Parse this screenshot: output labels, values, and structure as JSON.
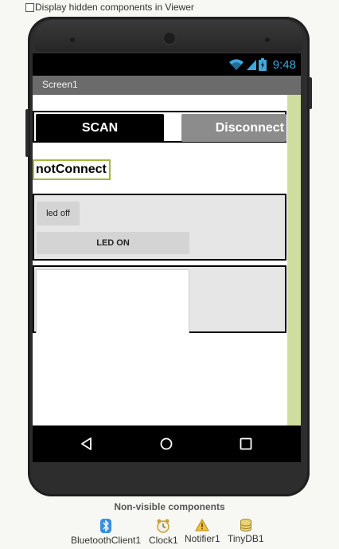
{
  "viewer": {
    "hidden_components_label": "Display hidden components in Viewer",
    "hidden_components_checked": false
  },
  "status_bar": {
    "time": "9:48",
    "icons": [
      "wifi-icon",
      "signal-icon",
      "battery-icon"
    ]
  },
  "screen": {
    "title": "Screen1"
  },
  "buttons": {
    "scan": "SCAN",
    "disconnect": "Disconnect",
    "led_off": "led off",
    "led_on": "LED ON"
  },
  "labels": {
    "connection_status": "notConnect"
  },
  "nav": {
    "icons": [
      "back-icon",
      "home-icon",
      "recents-icon"
    ]
  },
  "non_visible": {
    "title": "Non-visible components",
    "items": [
      {
        "label": "BluetoothClient1",
        "icon": "bluetooth-icon"
      },
      {
        "label": "Clock1",
        "icon": "clock-icon"
      },
      {
        "label": "Notifier1",
        "icon": "warning-icon"
      },
      {
        "label": "TinyDB1",
        "icon": "database-icon"
      }
    ]
  },
  "colors": {
    "accent_clock": "#3ea7e0",
    "label_border": "#a3b840",
    "side_stripe": "#cfdea0"
  }
}
